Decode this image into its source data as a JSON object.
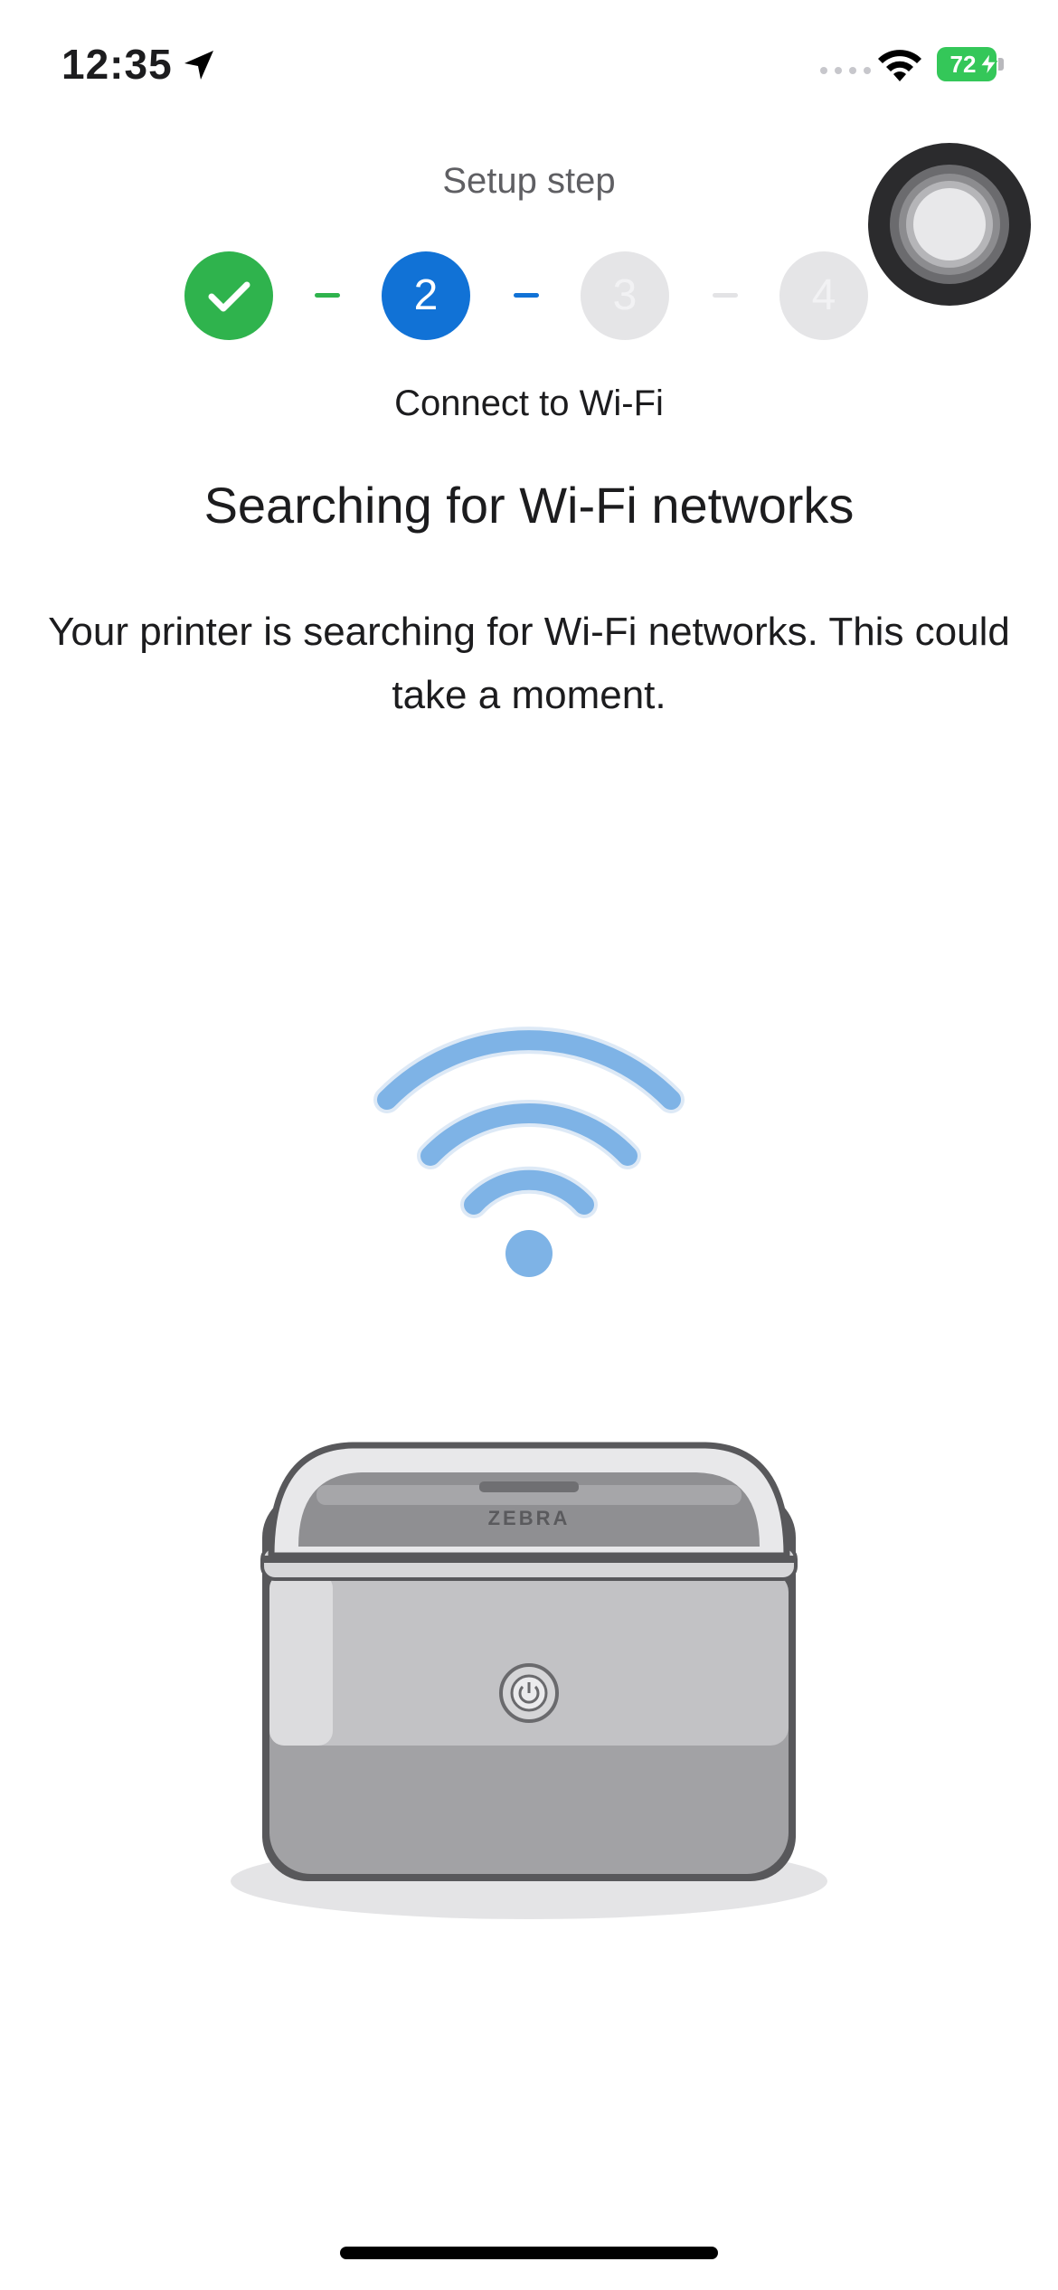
{
  "status_bar": {
    "time": "12:35",
    "battery_percent": "72",
    "icons": [
      "location-arrow-icon",
      "cellular-signal-icon",
      "wifi-icon",
      "battery-charging-icon"
    ]
  },
  "stepper": {
    "label": "Setup step",
    "steps": [
      {
        "label": "",
        "state": "complete",
        "icon": "checkmark-icon"
      },
      {
        "label": "2",
        "state": "current"
      },
      {
        "label": "3",
        "state": "upcoming"
      },
      {
        "label": "4",
        "state": "upcoming"
      }
    ],
    "current_caption": "Connect to Wi-Fi"
  },
  "main": {
    "title": "Searching for Wi-Fi networks",
    "description": "Your printer is searching for Wi-Fi networks. This could take a moment."
  },
  "illustration": {
    "wifi_icon": "wifi-searching-icon",
    "printer_brand": "ZEBRA"
  },
  "colors": {
    "complete": "#2fb34d",
    "current": "#1172d6",
    "upcoming": "#e5e5e7",
    "wifi_illustration": "#7eb3e6",
    "battery": "#34c759"
  }
}
